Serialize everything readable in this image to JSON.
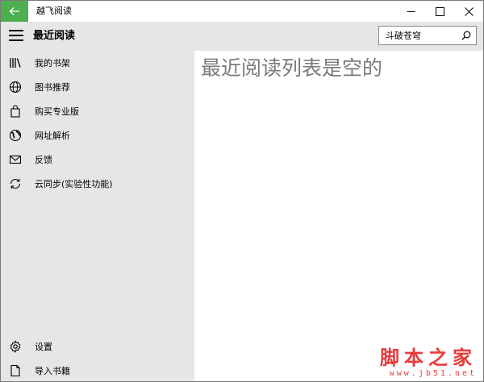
{
  "window": {
    "title": "越飞阅读",
    "accent_color": "#4caf50",
    "back_icon": "arrow-left-icon",
    "controls": [
      "minimize-icon",
      "maximize-icon",
      "close-icon"
    ]
  },
  "header": {
    "menu_icon": "hamburger-icon",
    "title": "最近阅读"
  },
  "search": {
    "value": "斗破苍穹",
    "placeholder": "",
    "icon": "search-icon"
  },
  "sidebar": {
    "items": [
      {
        "label": "我的书架",
        "icon": "bookshelf-icon"
      },
      {
        "label": "图书推荐",
        "icon": "globe-icon"
      },
      {
        "label": "购买专业版",
        "icon": "shopping-bag-icon"
      },
      {
        "label": "网址解析",
        "icon": "world-icon"
      },
      {
        "label": "反馈",
        "icon": "mail-icon"
      },
      {
        "label": "云同步(实验性功能)",
        "icon": "sync-icon"
      }
    ],
    "bottom_items": [
      {
        "label": "设置",
        "icon": "gear-icon"
      },
      {
        "label": "导入书籍",
        "icon": "document-icon"
      }
    ]
  },
  "main": {
    "empty_message": "最近阅读列表是空的"
  },
  "watermark": {
    "text": "脚本之家",
    "url": "www.jb51.net",
    "color": "#e83a3a"
  }
}
